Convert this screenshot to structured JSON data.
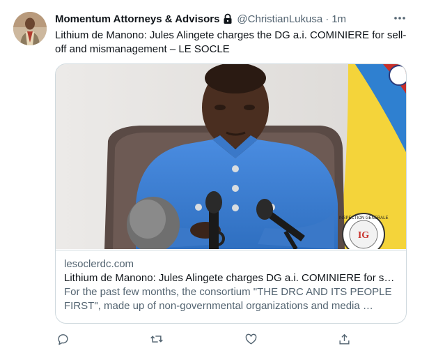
{
  "author": {
    "name": "Momentum Attorneys & Advisors",
    "handle": "@ChristianLukusa",
    "separator": "·",
    "time": "1m"
  },
  "icons": {
    "lock": "lock-icon",
    "more": "more-icon",
    "reply": "reply-icon",
    "retweet": "retweet-icon",
    "like": "like-icon",
    "share": "share-icon"
  },
  "tweet": {
    "text": "Lithium de Manono: Jules Alingete charges the DG a.i. COMINIERE for sell-off and mismanagement – LE SOCLE"
  },
  "card": {
    "domain": "lesoclerdc.com",
    "title": "Lithium de Manono: Jules Alingete charges DG a.i. COMINIERE for sell…",
    "description": "For the past few months, the consortium \"THE DRC AND ITS PEOPLE FIRST\", made up of non-governmental organizations and media …",
    "seal_text": "INSPECTION GENERALE"
  },
  "colors": {
    "text": "#0f1419",
    "secondary": "#536471",
    "border": "#cfd9de",
    "suit": "#3f7fd0",
    "flag_blue": "#2f80d0",
    "flag_yellow": "#f4d43a"
  }
}
